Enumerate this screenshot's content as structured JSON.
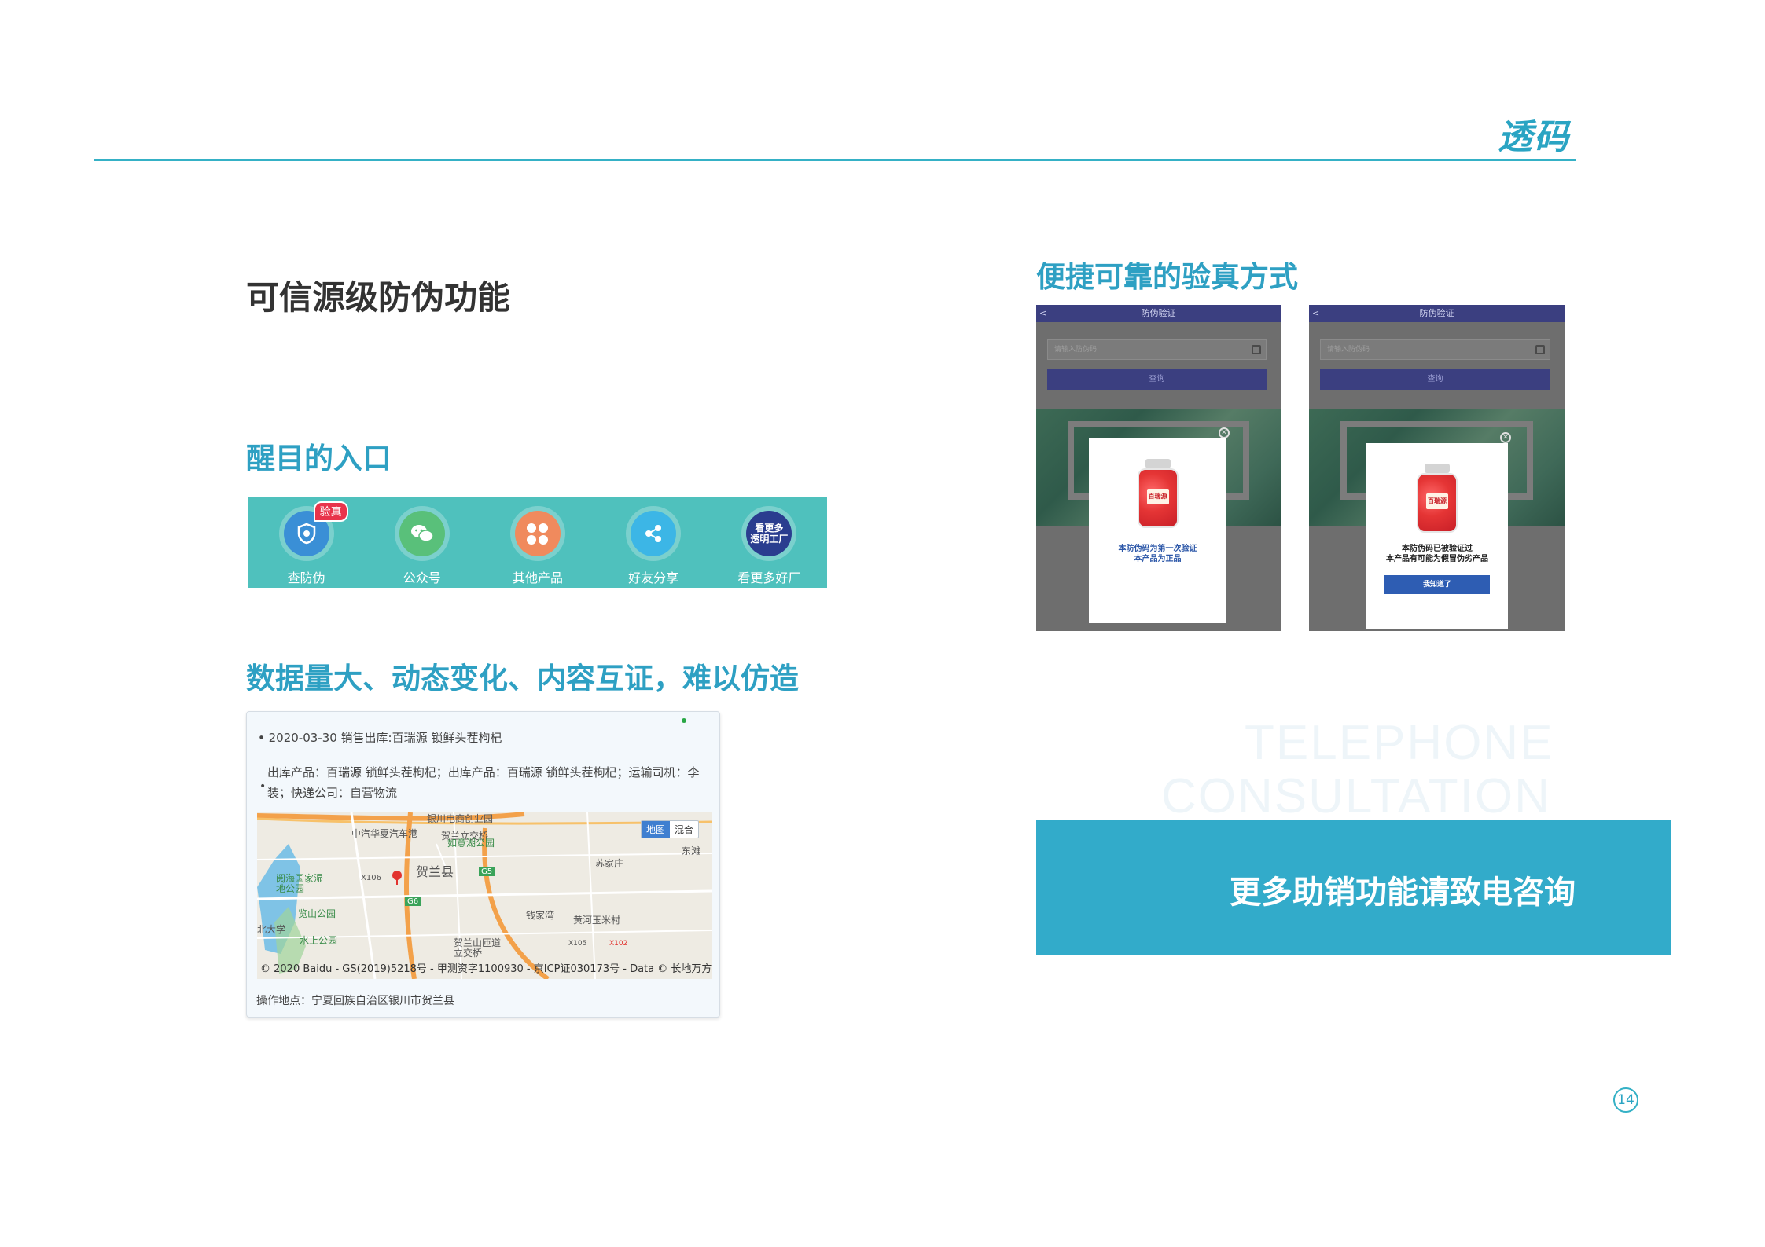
{
  "brand": "透码",
  "headings": {
    "main": "可信源级防伪功能",
    "entry": "醒目的入口",
    "data": "数据量大、动态变化、内容互证，难以仿造",
    "verify": "便捷可靠的验真方式"
  },
  "entry_bar": {
    "items": [
      {
        "label": "查防伪",
        "badge": "验真",
        "icon": "shield-scan-icon",
        "color": "#3a8fd6"
      },
      {
        "label": "公众号",
        "icon": "wechat-icon",
        "color": "#59c07a"
      },
      {
        "label": "其他产品",
        "icon": "grid-dots-icon",
        "color": "#f08a5d"
      },
      {
        "label": "好友分享",
        "icon": "share-icon",
        "color": "#3cb6e6"
      },
      {
        "label": "看更多好厂",
        "icon_text": "看更多\n透明工厂",
        "icon": "factory-badge-icon",
        "color": "#2a3d8f"
      }
    ]
  },
  "trace": {
    "date_line": "• 2020-03-30  销售出库:百瑞源 锁鲜头茬枸杞",
    "bullet": "•",
    "detail": "出库产品：百瑞源 锁鲜头茬枸杞；出库产品：百瑞源 锁鲜头茬枸杞；运输司机：李装；快递公司：自营物流",
    "map": {
      "toggle": [
        "地图",
        "混合"
      ],
      "labels": [
        "银川电商创业园",
        "中汽华夏汽车港",
        "贺兰立交桥",
        "如意湖公园",
        "苏家庄",
        "东滩",
        "X106",
        "贺兰县",
        "G5",
        "G6",
        "阅海国家湿地公园",
        "览山公园",
        "钱家湾",
        "黄河玉米村",
        "北大学",
        "水上公园",
        "贺兰山匝道立交桥",
        "X105",
        "X102"
      ],
      "copyright": "© 2020 Baidu - GS(2019)5218号 - 甲测资字1100930 - 京ICP证030173号 - Data © 长地万方"
    },
    "location": "操作地点：宁夏回族自治区银川市贺兰县"
  },
  "phones": [
    {
      "header": "防伪验证",
      "back": "<",
      "placeholder": "请输入防伪码",
      "query_btn": "查询",
      "jar_tag": "百瑞源",
      "message": [
        "本防伪码为第一次验证",
        "本产品为正品"
      ],
      "message_color": "#2c57a8"
    },
    {
      "header": "防伪验证",
      "back": "<",
      "placeholder": "请输入防伪码",
      "query_btn": "查询",
      "jar_tag": "百瑞源",
      "message": [
        "本防伪码已被验证过",
        "本产品有可能为假冒伪劣产品"
      ],
      "message_color": "#222222",
      "action": "我知道了"
    }
  ],
  "watermark": [
    "TELEPHONE",
    "CONSULTATION"
  ],
  "cta": "更多助销功能请致电咨询",
  "page_number": "14",
  "colors": {
    "accent": "#2ea0c3",
    "entry_bar": "#4fc1bd",
    "cta_bg": "#32abca",
    "phone_header": "#3b3f80"
  }
}
